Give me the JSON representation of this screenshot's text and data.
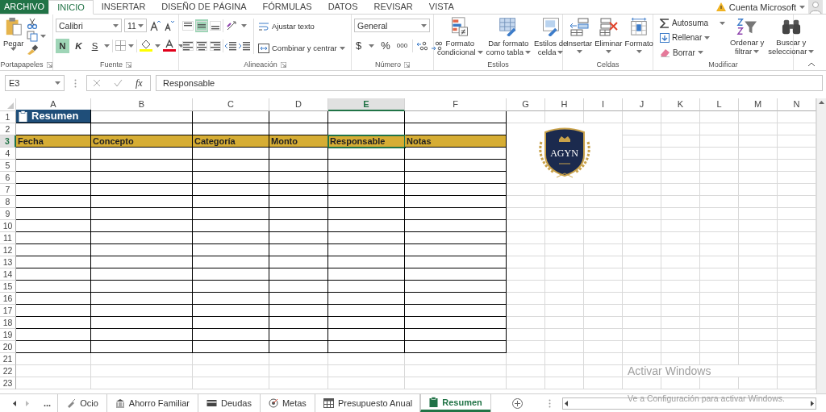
{
  "menu_tabs": [
    {
      "label": "ARCHIVO",
      "kind": "file",
      "selected": false
    },
    {
      "label": "INICIO",
      "kind": "tab",
      "selected": true
    },
    {
      "label": "INSERTAR",
      "kind": "tab",
      "selected": false
    },
    {
      "label": "DISEÑO DE PÁGINA",
      "kind": "tab",
      "selected": false
    },
    {
      "label": "FÓRMULAS",
      "kind": "tab",
      "selected": false
    },
    {
      "label": "DATOS",
      "kind": "tab",
      "selected": false
    },
    {
      "label": "REVISAR",
      "kind": "tab",
      "selected": false
    },
    {
      "label": "VISTA",
      "kind": "tab",
      "selected": false
    }
  ],
  "account": {
    "label": "Cuenta Microsoft"
  },
  "ribbon": [
    {
      "kind": "clipboard",
      "label": "Portapapeles",
      "paste": "Pegar"
    },
    {
      "kind": "font",
      "label": "Fuente",
      "font_name": "Calibri",
      "font_size": "11",
      "bold": {
        "label": "N",
        "on": true
      },
      "italic": {
        "label": "K",
        "on": false
      },
      "underline": {
        "label": "S",
        "on": false
      }
    },
    {
      "kind": "alignment",
      "label": "Alineación",
      "middle_align_on": true,
      "wrap": "Ajustar texto",
      "merge": "Combinar y centrar"
    },
    {
      "kind": "number",
      "label": "Número",
      "format": "General",
      "currency": "$",
      "percent": "%",
      "thousands": "000"
    },
    {
      "kind": "styles",
      "label": "Estilos",
      "buttons": [
        {
          "kind": "conditional",
          "lines": [
            "Formato",
            "condicional"
          ]
        },
        {
          "kind": "table",
          "lines": [
            "Dar formato",
            "como tabla"
          ]
        },
        {
          "kind": "cell_styles",
          "lines": [
            "Estilos de",
            "celda"
          ]
        }
      ]
    },
    {
      "kind": "cells",
      "label": "Celdas",
      "buttons": [
        {
          "kind": "insert",
          "label": "Insertar"
        },
        {
          "kind": "delete",
          "label": "Eliminar"
        },
        {
          "kind": "format",
          "label": "Formato"
        }
      ]
    },
    {
      "kind": "editing",
      "label": "Modificar",
      "small_buttons": [
        {
          "kind": "sum",
          "label": "Autosuma"
        },
        {
          "kind": "fill",
          "label": "Rellenar"
        },
        {
          "kind": "clear",
          "label": "Borrar"
        }
      ],
      "buttons": [
        {
          "kind": "sort",
          "lines": [
            "Ordenar y",
            "filtrar"
          ]
        },
        {
          "kind": "find",
          "lines": [
            "Buscar y",
            "seleccionar"
          ]
        }
      ]
    }
  ],
  "formula_bar": {
    "name_box": "E3",
    "function_label": "fx",
    "value": "Responsable"
  },
  "sheet": {
    "columns": [
      {
        "letter": "A",
        "selected": false
      },
      {
        "letter": "B",
        "selected": false
      },
      {
        "letter": "C",
        "selected": false
      },
      {
        "letter": "D",
        "selected": false
      },
      {
        "letter": "E",
        "selected": true
      },
      {
        "letter": "F",
        "selected": false
      },
      {
        "letter": "G",
        "selected": false
      },
      {
        "letter": "H",
        "selected": false
      },
      {
        "letter": "I",
        "selected": false
      },
      {
        "letter": "J",
        "selected": false
      },
      {
        "letter": "K",
        "selected": false
      },
      {
        "letter": "L",
        "selected": false
      },
      {
        "letter": "M",
        "selected": false
      },
      {
        "letter": "N",
        "selected": false
      }
    ],
    "rows": [
      {
        "number": "1",
        "kind": "title",
        "selected": false
      },
      {
        "number": "2",
        "kind": "table",
        "selected": false
      },
      {
        "number": "3",
        "kind": "header",
        "selected": true
      },
      {
        "number": "4",
        "kind": "table",
        "selected": false
      },
      {
        "number": "5",
        "kind": "table",
        "selected": false
      },
      {
        "number": "6",
        "kind": "table",
        "selected": false
      },
      {
        "number": "7",
        "kind": "table",
        "selected": false
      },
      {
        "number": "8",
        "kind": "table",
        "selected": false
      },
      {
        "number": "9",
        "kind": "table",
        "selected": false
      },
      {
        "number": "10",
        "kind": "table",
        "selected": false
      },
      {
        "number": "11",
        "kind": "table",
        "selected": false
      },
      {
        "number": "12",
        "kind": "table",
        "selected": false
      },
      {
        "number": "13",
        "kind": "table",
        "selected": false
      },
      {
        "number": "14",
        "kind": "table",
        "selected": false
      },
      {
        "number": "15",
        "kind": "table",
        "selected": false
      },
      {
        "number": "16",
        "kind": "table",
        "selected": false
      },
      {
        "number": "17",
        "kind": "table",
        "selected": false
      },
      {
        "number": "18",
        "kind": "table",
        "selected": false
      },
      {
        "number": "19",
        "kind": "table",
        "selected": false
      },
      {
        "number": "20",
        "kind": "table",
        "selected": false
      },
      {
        "number": "21",
        "kind": "blank",
        "selected": false
      },
      {
        "number": "22",
        "kind": "blank",
        "selected": false
      },
      {
        "number": "23",
        "kind": "blank",
        "selected": false
      }
    ],
    "title": "Resumen",
    "headers": [
      {
        "text": "Fecha",
        "selected": false
      },
      {
        "text": "Concepto",
        "selected": false
      },
      {
        "text": "Categoría",
        "selected": false
      },
      {
        "text": "Monto",
        "selected": false
      },
      {
        "text": "Responsable",
        "selected": true
      },
      {
        "text": "Notas",
        "selected": false
      }
    ],
    "logo": {
      "text": "AGYN"
    }
  },
  "sheet_tabs": {
    "more": "...",
    "tabs": [
      {
        "label": "Ocio",
        "kind": "leisure",
        "selected": false
      },
      {
        "label": "Ahorro Familiar",
        "kind": "bank",
        "selected": false
      },
      {
        "label": "Deudas",
        "kind": "card",
        "selected": false
      },
      {
        "label": "Metas",
        "kind": "target",
        "selected": false
      },
      {
        "label": "Presupuesto Anual",
        "kind": "calculator",
        "selected": false
      },
      {
        "label": "Resumen",
        "kind": "clipboard",
        "selected": true
      }
    ]
  },
  "activation_notice": {
    "title": "Activar Windows",
    "message": "Ve a Configuración para activar Windows."
  }
}
